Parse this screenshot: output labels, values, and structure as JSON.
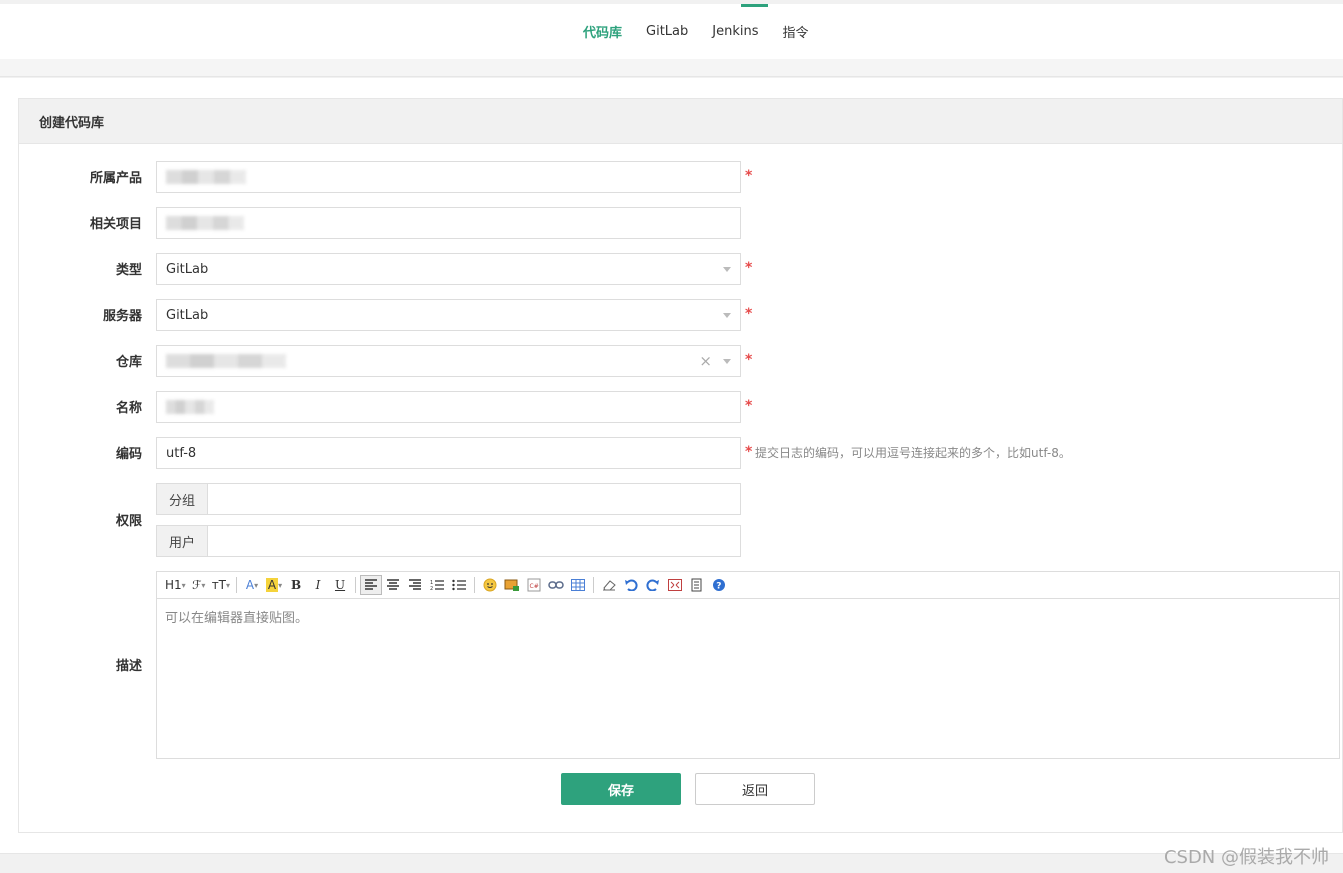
{
  "nav": {
    "items": [
      {
        "label": "代码库",
        "active": true
      },
      {
        "label": "GitLab",
        "active": false
      },
      {
        "label": "Jenkins",
        "active": false
      },
      {
        "label": "指令",
        "active": false
      }
    ]
  },
  "panel": {
    "title": "创建代码库"
  },
  "form": {
    "product_label": "所属产品",
    "project_label": "相关项目",
    "type_label": "类型",
    "type_value": "GitLab",
    "server_label": "服务器",
    "server_value": "GitLab",
    "repo_label": "仓库",
    "repo_clear": "×",
    "name_label": "名称",
    "encoding_label": "编码",
    "encoding_value": "utf-8",
    "encoding_hint": "提交日志的编码，可以用逗号连接起来的多个，比如utf-8。",
    "required_mark": "*",
    "permission_label": "权限",
    "group_addon": "分组",
    "user_addon": "用户",
    "description_label": "描述",
    "editor_placeholder": "可以在编辑器直接贴图。"
  },
  "toolbar": {
    "heading": "H1",
    "font": "ℱ",
    "size": "тT",
    "bold": "B",
    "italic": "I",
    "underline": "U"
  },
  "buttons": {
    "save": "保存",
    "back": "返回"
  },
  "watermark": "CSDN @假装我不帅",
  "colors": {
    "accent": "#2ea27d",
    "required": "#e64b4b"
  }
}
